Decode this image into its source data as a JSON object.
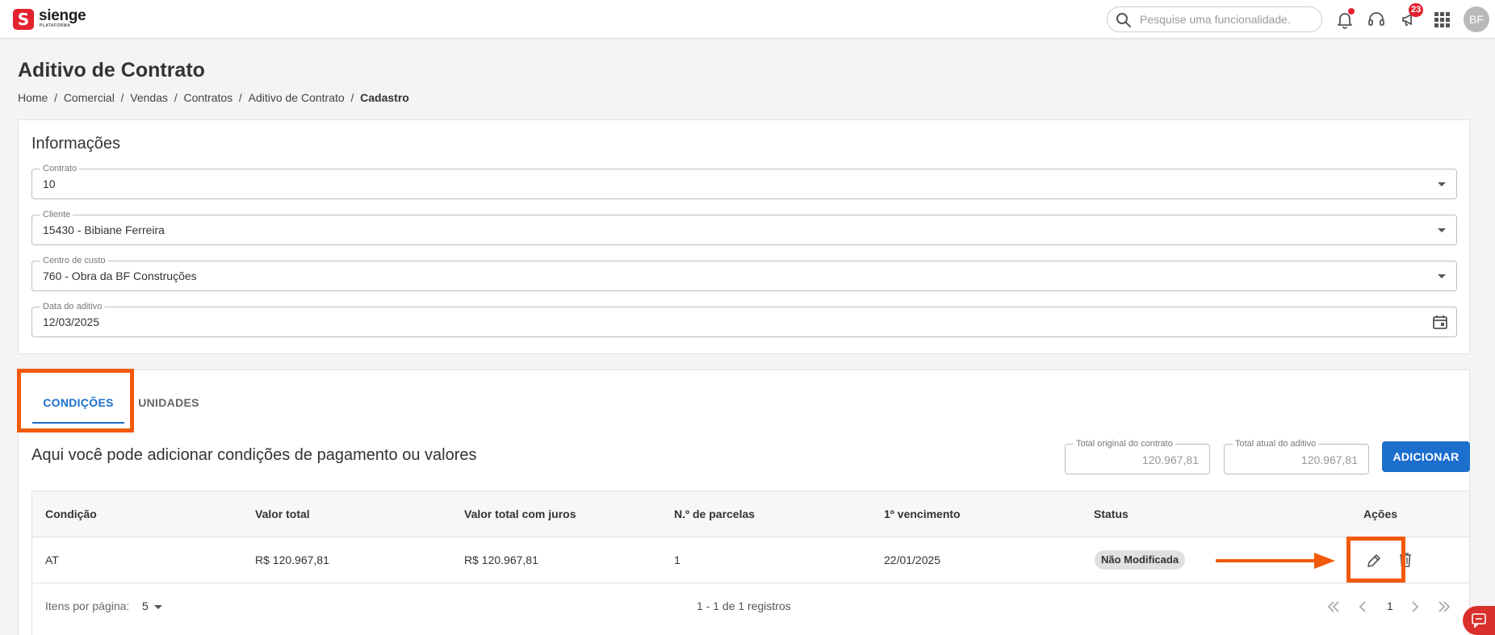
{
  "app": {
    "logo_name": "sienge",
    "logo_sub": "PLATAFORMA",
    "logo_mark": "S"
  },
  "header": {
    "search_placeholder": "Pesquise uma funcionalidade.",
    "notifications_badge": "23",
    "avatar_initials": "BF",
    "icons": [
      "search-icon",
      "bell-icon",
      "headset-icon",
      "megaphone-icon",
      "apps-grid-icon"
    ]
  },
  "page": {
    "title": "Aditivo de Contrato",
    "breadcrumb": [
      "Home",
      "Comercial",
      "Vendas",
      "Contratos",
      "Aditivo de Contrato",
      "Cadastro"
    ],
    "breadcrumb_separator": "/"
  },
  "informacoes": {
    "title": "Informações",
    "fields": [
      {
        "label": "Contrato",
        "value": "10",
        "type": "select"
      },
      {
        "label": "Cliente",
        "value": "15430 - Bibiane Ferreira",
        "type": "select"
      },
      {
        "label": "Centro de custo",
        "value": "760 - Obra da BF Construções",
        "type": "select"
      },
      {
        "label": "Data do aditivo",
        "value": "12/03/2025",
        "type": "date"
      }
    ]
  },
  "tabs": [
    {
      "label": "CONDIÇÕES",
      "active": true
    },
    {
      "label": "UNIDADES",
      "active": false
    }
  ],
  "condicoes": {
    "description": "Aqui você pode adicionar condições de pagamento ou valores",
    "total_original_label": "Total original do contrato",
    "total_original_value": "120.967,81",
    "total_atual_label": "Total atual do aditivo",
    "total_atual_value": "120.967,81",
    "add_label": "ADICIONAR",
    "columns": [
      "Condição",
      "Valor total",
      "Valor total com juros",
      "N.º de parcelas",
      "1º vencimento",
      "Status",
      "Ações"
    ],
    "rows": [
      {
        "condicao": "AT",
        "valor_total": "R$ 120.967,81",
        "valor_juros": "R$ 120.967,81",
        "parcelas": "1",
        "vencimento": "22/01/2025",
        "status": "Não Modificada"
      }
    ],
    "footer": {
      "per_page_label": "Itens por página:",
      "per_page_value": "5",
      "range_text": "1 - 1 de 1 registros",
      "current_page": "1"
    }
  },
  "colors": {
    "primary": "#1c6fcc",
    "brand_red": "#e4222e",
    "highlight_orange": "#f15a0a"
  }
}
